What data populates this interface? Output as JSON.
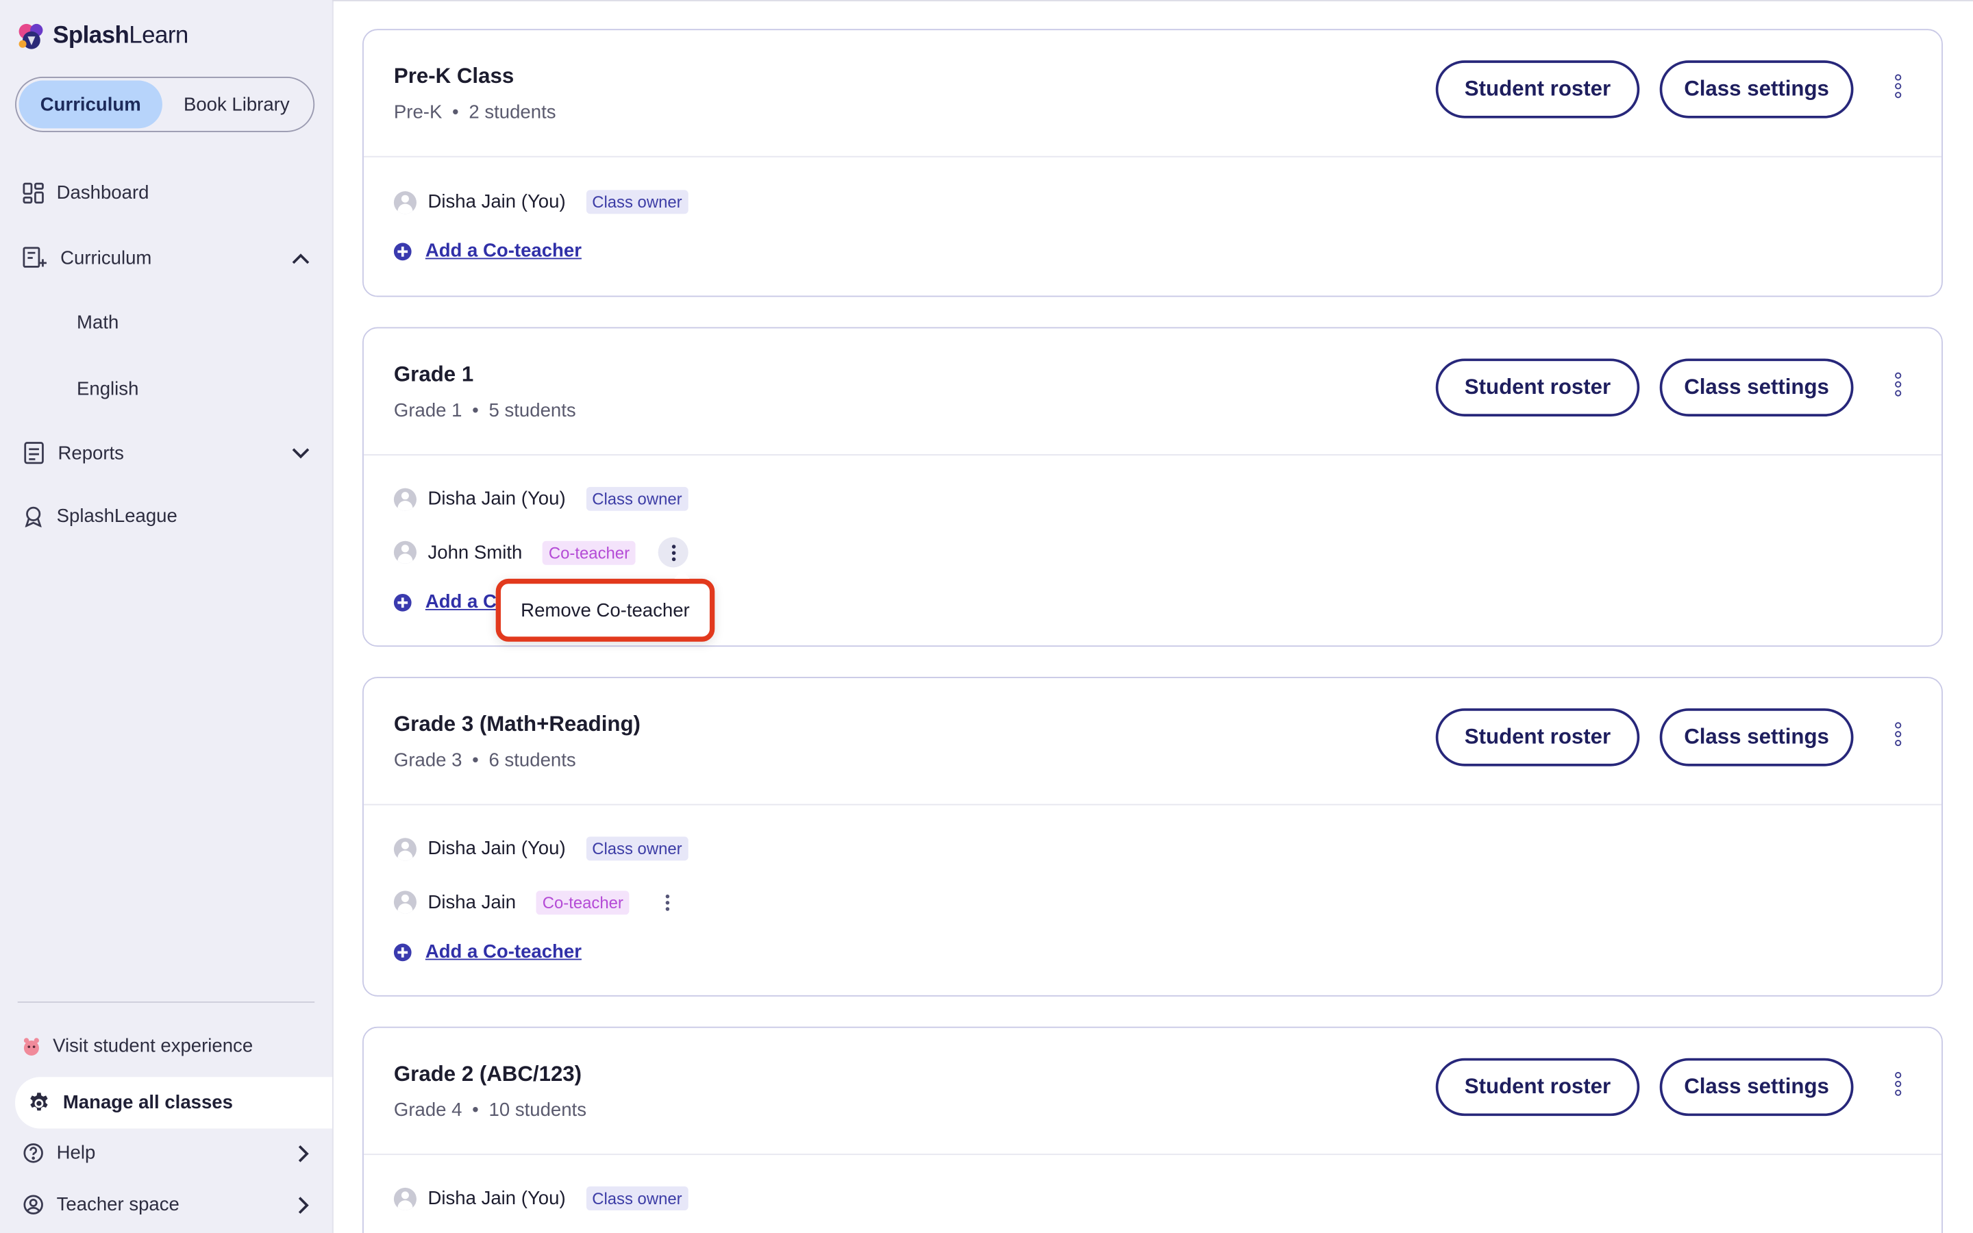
{
  "brand": {
    "name_bold": "Splash",
    "name_light": "Learn"
  },
  "toggle": {
    "active": "Curriculum",
    "inactive": "Book Library"
  },
  "sidebar": {
    "dashboard": "Dashboard",
    "curriculum": "Curriculum",
    "curriculum_sub": [
      "Math",
      "English"
    ],
    "reports": "Reports",
    "splashleague": "SplashLeague",
    "visit_student": "Visit student experience",
    "manage_classes": "Manage all classes",
    "help": "Help",
    "teacher_space": "Teacher space"
  },
  "buttons": {
    "roster": "Student roster",
    "settings": "Class settings",
    "add_co": "Add a Co-teacher"
  },
  "badges": {
    "owner": "Class owner",
    "co": "Co-teacher"
  },
  "popup": {
    "label": "Remove Co-teacher"
  },
  "classes": [
    {
      "title": "Pre-K Class",
      "grade": "Pre-K",
      "students": "2 students",
      "teachers": [
        {
          "name": "Disha Jain (You)",
          "role": "owner"
        }
      ]
    },
    {
      "title": "Grade 1",
      "grade": "Grade 1",
      "students": "5 students",
      "teachers": [
        {
          "name": "Disha Jain (You)",
          "role": "owner"
        },
        {
          "name": "John Smith",
          "role": "co"
        }
      ]
    },
    {
      "title": "Grade 3 (Math+Reading)",
      "grade": "Grade 3",
      "students": "6 students",
      "teachers": [
        {
          "name": "Disha Jain (You)",
          "role": "owner"
        },
        {
          "name": "Disha Jain",
          "role": "co"
        }
      ]
    },
    {
      "title": "Grade 2 (ABC/123)",
      "grade": "Grade 4",
      "students": "10 students",
      "teachers": [
        {
          "name": "Disha Jain (You)",
          "role": "owner"
        }
      ]
    }
  ],
  "colors": {
    "accent": "#27277a",
    "toggle_active": "#b7d4fb",
    "highlight": "#e2391d",
    "co_badge": "#b44bd6"
  }
}
